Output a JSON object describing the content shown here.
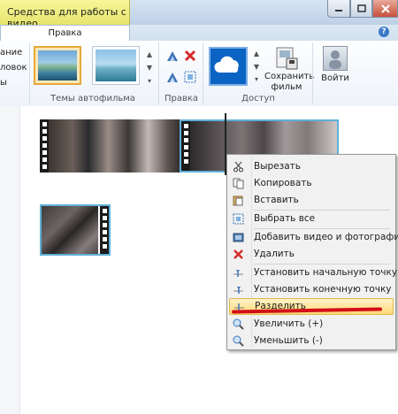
{
  "window": {
    "context_tab_title": "Средства для работы с видео",
    "tab": "Правка"
  },
  "ribbon": {
    "cut_texts": [
      "ание",
      "ловок",
      "ы"
    ],
    "group_labels": {
      "themes": "Темы автофильма",
      "edit": "Правка",
      "access": "Доступ"
    },
    "save_movie_label": "Сохранить фильм",
    "signin_label": "Войти"
  },
  "context_menu": {
    "items": [
      {
        "label": "Вырезать",
        "icon": "scissors-icon"
      },
      {
        "label": "Копировать",
        "icon": "copy-icon"
      },
      {
        "label": "Вставить",
        "icon": "paste-icon"
      },
      {
        "label": "Выбрать все",
        "icon": "select-all-icon"
      },
      {
        "label": "Добавить видео и фотографии",
        "icon": "add-media-icon"
      },
      {
        "label": "Удалить",
        "icon": "delete-icon"
      },
      {
        "label": "Установить начальную точку",
        "icon": "set-start-point-icon"
      },
      {
        "label": "Установить конечную точку",
        "icon": "set-end-point-icon"
      },
      {
        "label": "Разделить",
        "icon": "split-icon",
        "highlighted": true
      },
      {
        "label": "Увеличить (+)",
        "icon": "zoom-in-icon"
      },
      {
        "label": "Уменьшить (-)",
        "icon": "zoom-out-icon"
      }
    ]
  },
  "colors": {
    "context_tab": "#e6e46b",
    "highlight": "#ffd977",
    "accent_underline": "#d20f17",
    "onedrive_tile": "#0b63c4"
  }
}
